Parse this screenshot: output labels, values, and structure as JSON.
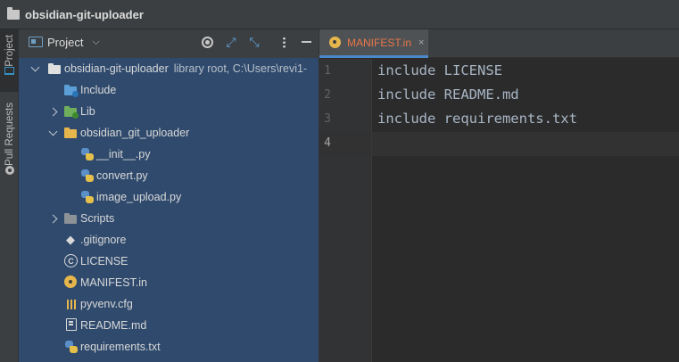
{
  "window": {
    "title": "obsidian-git-uploader"
  },
  "toolstrip": {
    "project_tab": "Project",
    "pull_requests_tab": "Pull Requests"
  },
  "project_panel": {
    "title": "Project",
    "header_icons": [
      "dropdown-chevron-icon",
      "locate-target-icon",
      "expand-all-icon",
      "collapse-all-icon",
      "more-options-icon",
      "hide-panel-icon"
    ]
  },
  "tree": {
    "root": {
      "name": "obsidian-git-uploader",
      "detail": "library root,  C:\\Users\\revi1-"
    },
    "items": [
      {
        "label": "Include",
        "icon": "folder-blue-icon"
      },
      {
        "label": "Lib",
        "icon": "folder-green-icon"
      },
      {
        "label": "obsidian_git_uploader",
        "icon": "folder-yellow-icon"
      },
      {
        "label": "__init__.py",
        "icon": "python-file-icon"
      },
      {
        "label": "convert.py",
        "icon": "python-file-icon"
      },
      {
        "label": "image_upload.py",
        "icon": "python-file-icon"
      },
      {
        "label": "Scripts",
        "icon": "folder-grey-icon"
      },
      {
        "label": ".gitignore",
        "icon": "gitignore-icon"
      },
      {
        "label": "LICENSE",
        "icon": "copyright-icon"
      },
      {
        "label": "MANIFEST.in",
        "icon": "gear-file-icon"
      },
      {
        "label": "pyvenv.cfg",
        "icon": "config-file-icon"
      },
      {
        "label": "README.md",
        "icon": "markdown-file-icon"
      },
      {
        "label": "requirements.txt",
        "icon": "python-file-icon"
      }
    ]
  },
  "editor": {
    "tab": {
      "label": "MANIFEST.in",
      "close": "×"
    },
    "line_numbers": [
      "1",
      "2",
      "3",
      "4"
    ],
    "lines": [
      "include LICENSE",
      "include README.md",
      "include requirements.txt",
      ""
    ],
    "current_line": 4
  },
  "colors": {
    "selection": "#2f4a6d",
    "tab_text": "#e8764b",
    "tab_underline": "#4a88c7",
    "code_text": "#a9b7c6"
  }
}
